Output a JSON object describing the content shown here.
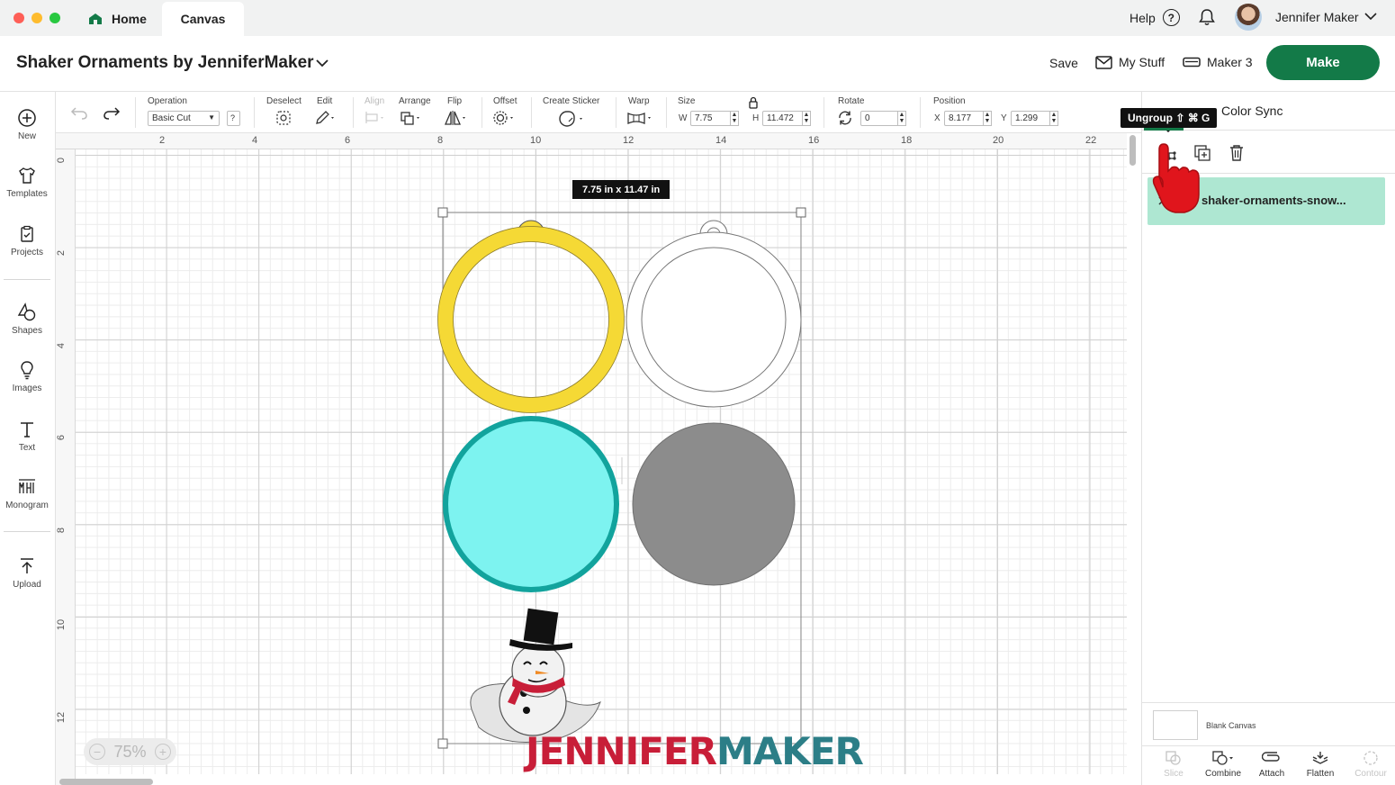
{
  "window": {
    "tabs": [
      {
        "label": "Home",
        "active": false
      },
      {
        "label": "Canvas",
        "active": true
      }
    ]
  },
  "topbar": {
    "help_label": "Help",
    "help_icon": "?",
    "user_name": "Jennifer Maker"
  },
  "header": {
    "project_title": "Shaker Ornaments by JenniferMaker",
    "save_label": "Save",
    "mystuff_label": "My Stuff",
    "machine_label": "Maker 3",
    "make_label": "Make"
  },
  "sidebar": {
    "items": [
      {
        "label": "New",
        "icon": "plus-circle-icon"
      },
      {
        "label": "Templates",
        "icon": "shirt-icon"
      },
      {
        "label": "Projects",
        "icon": "projects-icon"
      },
      {
        "label": "Shapes",
        "icon": "shapes-icon"
      },
      {
        "label": "Images",
        "icon": "lightbulb-icon"
      },
      {
        "label": "Text",
        "icon": "text-icon"
      },
      {
        "label": "Monogram",
        "icon": "monogram-icon"
      },
      {
        "label": "Upload",
        "icon": "upload-icon"
      }
    ]
  },
  "toolbar": {
    "operation_label": "Operation",
    "operation_value": "Basic Cut",
    "operation_help": "?",
    "deselect_label": "Deselect",
    "edit_label": "Edit",
    "align_label": "Align",
    "arrange_label": "Arrange",
    "flip_label": "Flip",
    "offset_label": "Offset",
    "sticker_label": "Create Sticker",
    "warp_label": "Warp",
    "size_label": "Size",
    "size_w_prefix": "W",
    "size_w": "7.75",
    "size_h_prefix": "H",
    "size_h": "11.472",
    "rotate_label": "Rotate",
    "rotate_value": "0",
    "position_label": "Position",
    "pos_x_prefix": "X",
    "pos_x": "8.177",
    "pos_y_prefix": "Y",
    "pos_y": "1.299"
  },
  "canvas": {
    "ruler_top": [
      "2",
      "4",
      "6",
      "8",
      "10",
      "12",
      "14",
      "16",
      "18",
      "20",
      "22"
    ],
    "ruler_left": [
      "0",
      "2",
      "4",
      "6",
      "8",
      "10",
      "12"
    ],
    "size_tooltip": "7.75  in x 11.47  in",
    "zoom_level": "75%",
    "zoom_minus": "−",
    "zoom_plus": "+",
    "watermark_part1": "JENNIFER",
    "watermark_part2": "MAKER",
    "colors": {
      "yellow_ring": "#f5d935",
      "teal_fill": "#7df3f0",
      "teal_edge": "#12a39d",
      "gray_circle": "#8c8c8c",
      "brand_green": "#137a48",
      "watermark_red": "#c81e38",
      "watermark_teal": "#2c7e87"
    }
  },
  "right_panel": {
    "ungroup_tooltip": "Ungroup ⇧ ⌘ G",
    "color_sync_label": "Color Sync",
    "layer_name": "shaker-ornaments-snow...",
    "blank_canvas_label": "Blank Canvas",
    "bottom_tools": [
      {
        "label": "Slice",
        "enabled": false
      },
      {
        "label": "Combine",
        "enabled": true
      },
      {
        "label": "Attach",
        "enabled": true
      },
      {
        "label": "Flatten",
        "enabled": true
      },
      {
        "label": "Contour",
        "enabled": false
      }
    ]
  }
}
